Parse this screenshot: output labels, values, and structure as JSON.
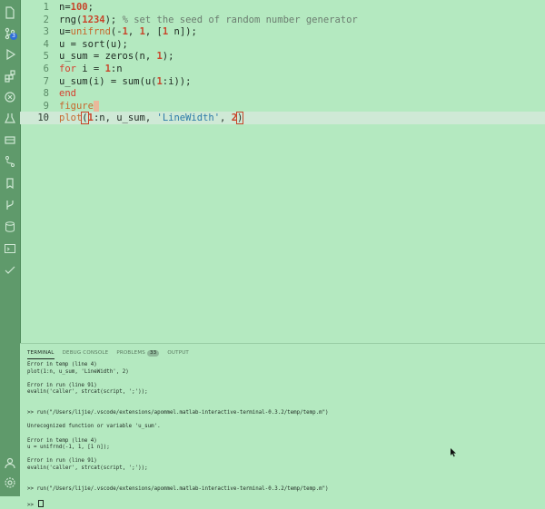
{
  "editor": {
    "lines": [
      {
        "n": "1",
        "tokens": [
          {
            "t": "n=",
            "c": ""
          },
          {
            "t": "100",
            "c": "num"
          },
          {
            "t": ";",
            "c": ""
          }
        ]
      },
      {
        "n": "2",
        "tokens": [
          {
            "t": "rng(",
            "c": ""
          },
          {
            "t": "1234",
            "c": "num"
          },
          {
            "t": "); ",
            "c": ""
          },
          {
            "t": "% set the seed of random number generator",
            "c": "cmt"
          }
        ]
      },
      {
        "n": "3",
        "tokens": [
          {
            "t": "u=",
            "c": ""
          },
          {
            "t": "unifrnd",
            "c": "fnc"
          },
          {
            "t": "(-",
            "c": ""
          },
          {
            "t": "1",
            "c": "num"
          },
          {
            "t": ", ",
            "c": ""
          },
          {
            "t": "1",
            "c": "num"
          },
          {
            "t": ", [",
            "c": ""
          },
          {
            "t": "1",
            "c": "num"
          },
          {
            "t": " n]);",
            "c": ""
          }
        ]
      },
      {
        "n": "4",
        "tokens": [
          {
            "t": "u = sort(u);",
            "c": ""
          }
        ]
      },
      {
        "n": "5",
        "tokens": [
          {
            "t": "u_sum = zeros(n, ",
            "c": ""
          },
          {
            "t": "1",
            "c": "num"
          },
          {
            "t": ");",
            "c": ""
          }
        ]
      },
      {
        "n": "6",
        "tokens": [
          {
            "t": "for",
            "c": "kw"
          },
          {
            "t": " i = ",
            "c": ""
          },
          {
            "t": "1",
            "c": "num"
          },
          {
            "t": ":n",
            "c": ""
          }
        ]
      },
      {
        "n": "7",
        "tokens": [
          {
            "t": "u_sum(i) = sum(u(",
            "c": ""
          },
          {
            "t": "1",
            "c": "num"
          },
          {
            "t": ":i));",
            "c": ""
          }
        ]
      },
      {
        "n": "8",
        "tokens": [
          {
            "t": "end",
            "c": "kw"
          }
        ]
      },
      {
        "n": "9",
        "tokens": [
          {
            "t": "figure",
            "c": "fnc"
          },
          {
            "t": " ",
            "c": "hl"
          }
        ]
      },
      {
        "n": "10",
        "tokens": [
          {
            "t": "plot",
            "c": "fnc"
          },
          {
            "t": "(",
            "c": "hlbox"
          },
          {
            "t": "1",
            "c": "num"
          },
          {
            "t": ":n, u_sum, ",
            "c": ""
          },
          {
            "t": "'LineWidth'",
            "c": "str"
          },
          {
            "t": ", ",
            "c": ""
          },
          {
            "t": "2",
            "c": "num"
          },
          {
            "t": ")",
            "c": "hlbox"
          }
        ]
      }
    ],
    "current_line": 10
  },
  "panel": {
    "tabs": [
      {
        "label": "TERMINAL",
        "active": true
      },
      {
        "label": "DEBUG CONSOLE",
        "active": false
      },
      {
        "label": "PROBLEMS",
        "active": false,
        "count": "33"
      },
      {
        "label": "OUTPUT",
        "active": false
      }
    ],
    "terminal_lines": [
      "Error in temp (line 4)",
      "plot(1:n, u_sum, 'LineWidth', 2)",
      "",
      "Error in run (line 91)",
      "evalin('caller', strcat(script, ';'));",
      "",
      "",
      ">> run(\"/Users/lijie/.vscode/extensions/apommel.matlab-interactive-terminal-0.3.2/temp/temp.m\")",
      "",
      "Unrecognized function or variable 'u_sum'.",
      "",
      "Error in temp (line 4)",
      "u = unifrnd(-1, 1, [1 n]);",
      "",
      "Error in run (line 91)",
      "evalin('caller', strcat(script, ';'));",
      "",
      "",
      ">> run(\"/Users/lijie/.vscode/extensions/apommel.matlab-interactive-terminal-0.3.2/temp/temp.m\")",
      "",
      ">> "
    ]
  },
  "activity_bar": {
    "icons": [
      "explorer-icon",
      "source-control-icon",
      "run-debug-icon",
      "extensions-icon",
      "remote-icon",
      "testing-icon",
      "docker-icon",
      "git-graph-icon",
      "timeline-icon",
      "bookmarks-icon",
      "branch-icon",
      "database-icon",
      "terminal-icon",
      "check-icon",
      "account-icon",
      "settings-icon"
    ],
    "source_control_badge": "3"
  },
  "colors": {
    "background": "#b4e9c0",
    "activity_bar": "#5f9a6b",
    "current_line": "#cfe9d6"
  }
}
